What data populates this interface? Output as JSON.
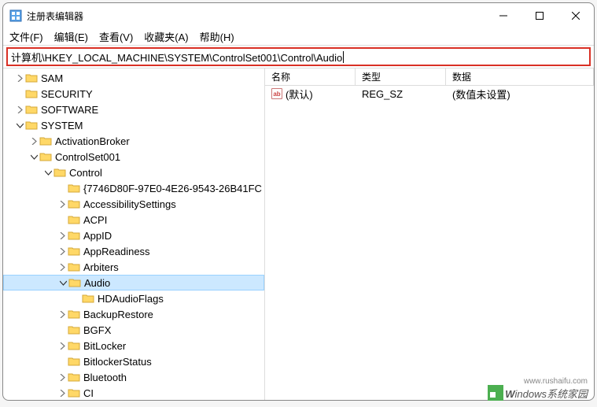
{
  "window": {
    "title": "注册表编辑器"
  },
  "menubar": {
    "file": "文件(F)",
    "edit": "编辑(E)",
    "view": "查看(V)",
    "favorites": "收藏夹(A)",
    "help": "帮助(H)"
  },
  "addressbar": {
    "path": "计算机\\HKEY_LOCAL_MACHINE\\SYSTEM\\ControlSet001\\Control\\Audio"
  },
  "tree": {
    "sam": "SAM",
    "security": "SECURITY",
    "software": "SOFTWARE",
    "system": "SYSTEM",
    "activationbroker": "ActivationBroker",
    "controlset001": "ControlSet001",
    "control": "Control",
    "guid": "{7746D80F-97E0-4E26-9543-26B41FC",
    "accessibility": "AccessibilitySettings",
    "acpi": "ACPI",
    "appid": "AppID",
    "appreadiness": "AppReadiness",
    "arbiters": "Arbiters",
    "audio": "Audio",
    "hdaudioflags": "HDAudioFlags",
    "backuprestore": "BackupRestore",
    "bgfx": "BGFX",
    "bitlocker": "BitLocker",
    "bitlockerstatus": "BitlockerStatus",
    "bluetooth": "Bluetooth",
    "ci": "CI"
  },
  "list": {
    "headers": {
      "name": "名称",
      "type": "类型",
      "data": "数据"
    },
    "rows": [
      {
        "name": "(默认)",
        "type": "REG_SZ",
        "data": "(数值未设置)"
      }
    ]
  },
  "watermark": {
    "brand_w": "W",
    "brand_rest": "indows",
    "suffix": "系统家园",
    "url": "www.rushaifu.com"
  }
}
